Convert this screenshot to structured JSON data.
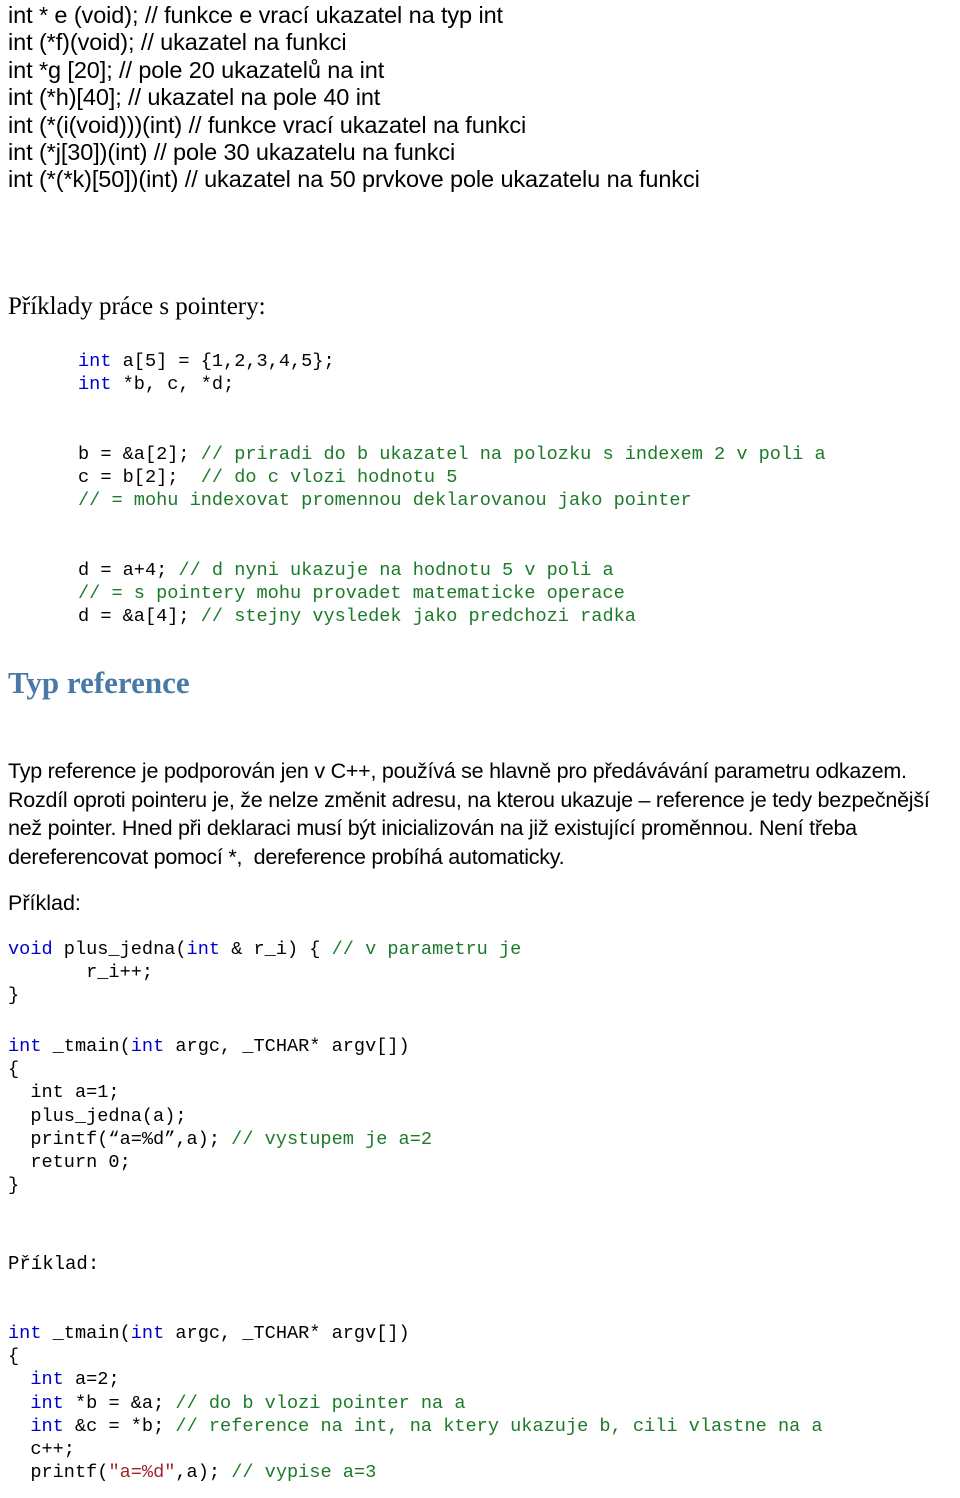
{
  "document": {
    "language": "cs",
    "colors": {
      "keyword": "#0000d0",
      "comment": "#1d7a29",
      "string": "#a3232b",
      "heading_blue": "#4a79a8",
      "text": "#000000",
      "background": "#ffffff"
    }
  },
  "declarations": {
    "lines": [
      "int * e (void); // funkce e vrací ukazatel na typ int",
      "int (*f)(void); // ukazatel na funkci",
      "int *g [20]; // pole 20 ukazatelů na int",
      "int (*h)[40]; // ukazatel na pole 40 int",
      "int (*(i(void)))(int) // funkce vrací ukazatel na funkci",
      "int (*j[30])(int) // pole 30 ukazatelu na funkci",
      "int (*(*k)[50])(int) // ukazatel na 50 prvkove pole ukazatelu na funkci"
    ]
  },
  "headings": {
    "priklady_pointery": "Příklady práce s pointery:",
    "typ_reference": "Typ reference"
  },
  "paragraph_typ_reference": {
    "lines": [
      "Typ reference je podporován jen v C++, používá se hlavně pro předávávání parametru odkazem.",
      "Rozdíl oproti pointeru je, že nelze změnit adresu, na kterou ukazuje – reference je tedy bezpečnější",
      "než pointer. Hned při deklaraci musí být inicializován na již existující proměnnou. Není třeba",
      "dereferencovat pomocí *,  dereference probíhá automaticky."
    ]
  },
  "labels": {
    "priklad_1": "Příklad:",
    "priklad_2": "Příklad:"
  },
  "code_pointer_examples": {
    "lines": [
      [
        {
          "t": "int",
          "c": "kw"
        },
        {
          "t": " a[5] = {1,2,3,4,5};",
          "c": "pln"
        }
      ],
      [
        {
          "t": "int",
          "c": "kw"
        },
        {
          "t": " *b, c, *d;",
          "c": "pln"
        }
      ],
      [],
      [],
      [
        {
          "t": "b = &a[2]; ",
          "c": "pln"
        },
        {
          "t": "// priradi do b ukazatel na polozku s indexem 2 v poli a",
          "c": "cmt"
        }
      ],
      [
        {
          "t": "c = b[2];  ",
          "c": "pln"
        },
        {
          "t": "// do c vlozi hodnotu 5",
          "c": "cmt"
        }
      ],
      [
        {
          "t": "// = mohu indexovat promennou deklarovanou jako pointer",
          "c": "cmt"
        }
      ],
      [],
      [],
      [
        {
          "t": "d = a+4; ",
          "c": "pln"
        },
        {
          "t": "// d nyni ukazuje na hodnotu 5 v poli a",
          "c": "cmt"
        }
      ],
      [
        {
          "t": "// = s pointery mohu provadet matematicke operace",
          "c": "cmt"
        }
      ],
      [
        {
          "t": "d = &a[4]; ",
          "c": "pln"
        },
        {
          "t": "// stejny vysledek jako predchozi radka",
          "c": "cmt"
        }
      ]
    ]
  },
  "code_plus_jedna": {
    "lines": [
      [
        {
          "t": "void",
          "c": "kw"
        },
        {
          "t": " plus_jedna(",
          "c": "pln"
        },
        {
          "t": "int",
          "c": "kw"
        },
        {
          "t": " & r_i) { ",
          "c": "pln"
        },
        {
          "t": "// v parametru je",
          "c": "cmt"
        }
      ],
      [
        {
          "t": "       r_i++;",
          "c": "pln"
        }
      ],
      [
        {
          "t": "}",
          "c": "pln"
        }
      ]
    ]
  },
  "code_tmain_1": {
    "lines": [
      [
        {
          "t": "int",
          "c": "kw"
        },
        {
          "t": " _tmain(",
          "c": "pln"
        },
        {
          "t": "int",
          "c": "kw"
        },
        {
          "t": " argc, _TCHAR* argv[])",
          "c": "pln"
        }
      ],
      [
        {
          "t": "{",
          "c": "pln"
        }
      ],
      [
        {
          "t": "  int a=1;",
          "c": "pln"
        }
      ],
      [
        {
          "t": "  plus_jedna(a);",
          "c": "pln"
        }
      ],
      [
        {
          "t": "  printf(“a=%d”,a); ",
          "c": "pln"
        },
        {
          "t": "// vystupem je a=2",
          "c": "cmt"
        }
      ],
      [
        {
          "t": "  return 0;",
          "c": "pln"
        }
      ],
      [
        {
          "t": "}",
          "c": "pln"
        }
      ]
    ]
  },
  "code_tmain_2": {
    "lines": [
      [
        {
          "t": "int",
          "c": "kw"
        },
        {
          "t": " _tmain(",
          "c": "pln"
        },
        {
          "t": "int",
          "c": "kw"
        },
        {
          "t": " argc, _TCHAR* argv[])",
          "c": "pln"
        }
      ],
      [
        {
          "t": "{",
          "c": "pln"
        }
      ],
      [
        {
          "t": "  ",
          "c": "pln"
        },
        {
          "t": "int",
          "c": "kw"
        },
        {
          "t": " a=2;",
          "c": "pln"
        }
      ],
      [
        {
          "t": "  ",
          "c": "pln"
        },
        {
          "t": "int",
          "c": "kw"
        },
        {
          "t": " *b = &a; ",
          "c": "pln"
        },
        {
          "t": "// do b vlozi pointer na a",
          "c": "cmt"
        }
      ],
      [
        {
          "t": "  ",
          "c": "pln"
        },
        {
          "t": "int",
          "c": "kw"
        },
        {
          "t": " &c = *b; ",
          "c": "pln"
        },
        {
          "t": "// reference na int, na ktery ukazuje b, cili vlastne na a",
          "c": "cmt"
        }
      ],
      [
        {
          "t": "  c++;",
          "c": "pln"
        }
      ],
      [
        {
          "t": "  printf(",
          "c": "pln"
        },
        {
          "t": "\"a=%d\"",
          "c": "str"
        },
        {
          "t": ",a); ",
          "c": "pln"
        },
        {
          "t": "// vypise a=3",
          "c": "cmt"
        }
      ]
    ]
  }
}
